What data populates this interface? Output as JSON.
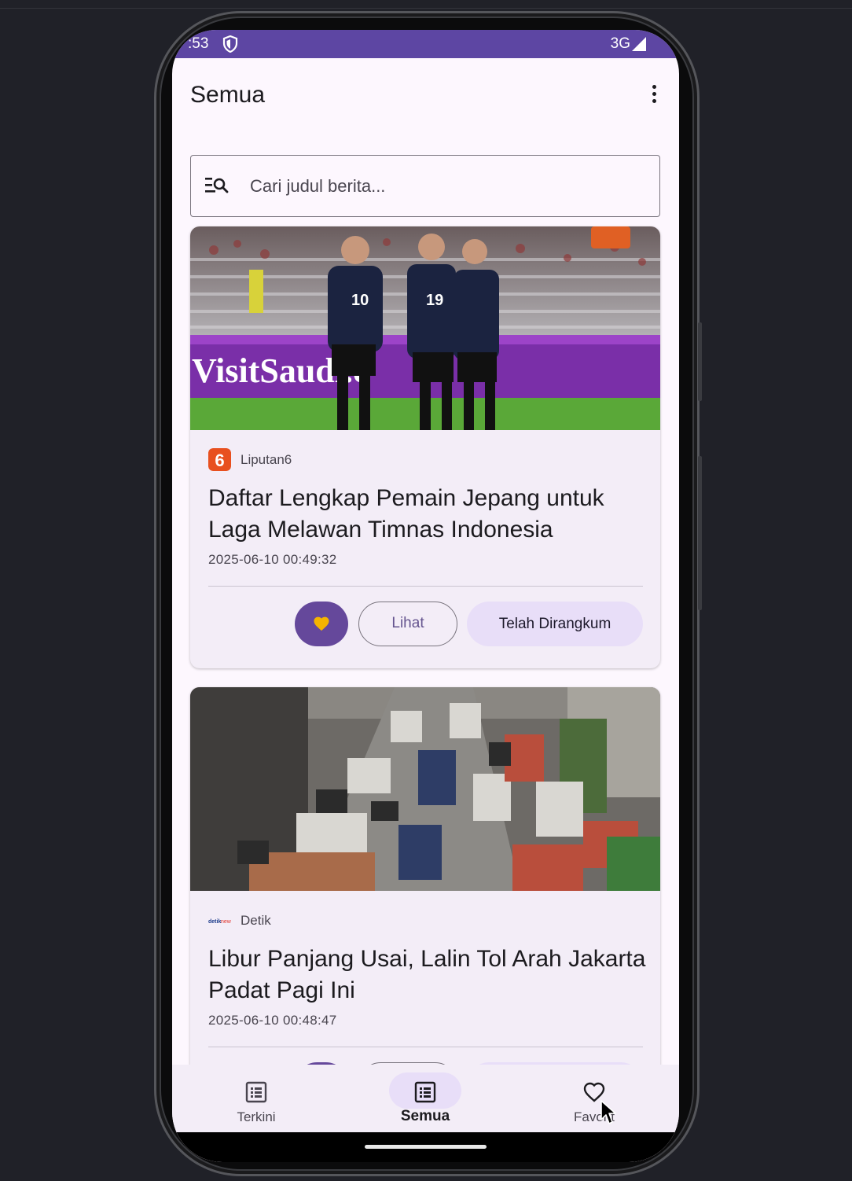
{
  "status_bar": {
    "time": ":53",
    "network": "3G"
  },
  "app_bar": {
    "title": "Semua"
  },
  "search": {
    "placeholder": "Cari judul berita..."
  },
  "articles": [
    {
      "source": "Liputan6",
      "title": "Daftar Lengkap Pemain Jepang untuk Laga Melawan Timnas Indonesia",
      "date": "2025-06-10 00:49:32",
      "image_text": "VisitSaudi.c",
      "favorited": true
    },
    {
      "source": "Detik",
      "title": "Libur Panjang Usai, Lalin Tol Arah Jakarta Padat Pagi Ini",
      "date": "2025-06-10 00:48:47",
      "favorited": true
    }
  ],
  "actions": {
    "view_label": "Lihat",
    "summarized_label": "Telah Dirangkum"
  },
  "bottom_nav": [
    {
      "label": "Terkini",
      "icon": "list-alt-icon",
      "active": false
    },
    {
      "label": "Semua",
      "icon": "article-list-icon",
      "active": true
    },
    {
      "label": "Favorit",
      "icon": "heart-outline-icon",
      "active": false
    }
  ],
  "colors": {
    "status_bar": "#5d46a3",
    "primary": "#65489b",
    "favorite_heart": "#f5b400",
    "tonal_button": "#e8def8",
    "surface": "#fdf7fe",
    "card": "#f3edf7"
  }
}
